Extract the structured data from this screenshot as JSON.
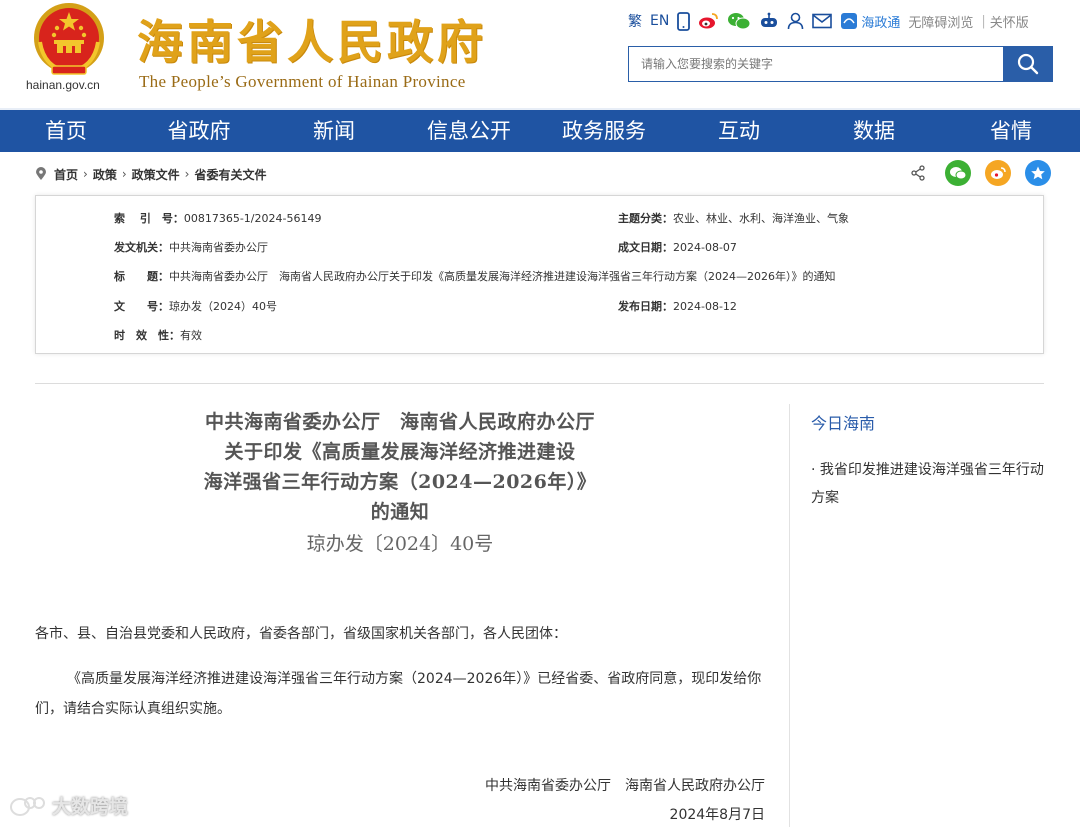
{
  "header": {
    "domain": "hainan.gov.cn",
    "title": "海南省人民政府",
    "subtitle": "The People’s Government  of Hainan Province",
    "traditional": "繁",
    "english": "EN",
    "hzt_label": "海政通",
    "accessibility": "无障碍浏览",
    "divider": "|",
    "care_version": "关怀版",
    "search_placeholder": "请输入您要搜索的关键字",
    "accent": "#1f54a3",
    "title_color": "#e0a21a"
  },
  "nav": {
    "items": [
      "首页",
      "省政府",
      "新闻",
      "信息公开",
      "政务服务",
      "互动",
      "数据",
      "省情"
    ]
  },
  "breadcrumb": [
    "首页",
    "政策",
    "政策文件",
    "省委有关文件"
  ],
  "info": {
    "index_label": "索　 引　号：",
    "index_value": "00817365-1/2024-56149",
    "category_label": "主题分类：",
    "category_value": "农业、林业、水利、海洋渔业、气象",
    "issuer_label": "发文机关：",
    "issuer_value": "中共海南省委办公厅",
    "date_made_label": "成文日期：",
    "date_made_value": "2024-08-07",
    "title_label": "标　　题：",
    "title_value": "中共海南省委办公厅　海南省人民政府办公厅关于印发《高质量发展海洋经济推进建设海洋强省三年行动方案（2024—2026年）》的通知",
    "docno_label": "文　　号：",
    "docno_value": "琼办发（2024）40号",
    "pub_date_label": "发布日期：",
    "pub_date_value": "2024-08-12",
    "validity_label": "时　效　性：",
    "validity_value": "有效"
  },
  "article": {
    "title_lines": [
      "中共海南省委办公厅　海南省人民政府办公厅",
      "关于印发《高质量发展海洋经济推进建设",
      "海洋强省三年行动方案（2024—2026年）》",
      "的通知"
    ],
    "doc_number": "琼办发〔2024〕40号",
    "salutation": "各市、县、自治县党委和人民政府，省委各部门，省级国家机关各部门，各人民团体：",
    "body": "《高质量发展海洋经济推进建设海洋强省三年行动方案（2024—2026年）》已经省委、省政府同意，现印发给你们，请结合实际认真组织实施。",
    "signature": "中共海南省委办公厅　海南省人民政府办公厅",
    "date": "2024年8月7日"
  },
  "sidebar": {
    "heading": "今日海南",
    "items": [
      "· 我省印发推进建设海洋强省三年行动方案"
    ]
  },
  "watermark": "大数跨境"
}
